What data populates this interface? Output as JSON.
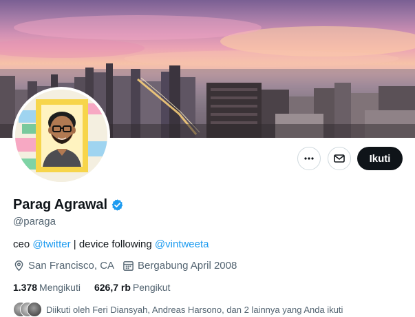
{
  "profile": {
    "display_name": "Parag Agrawal",
    "handle": "@paraga",
    "verified_icon": "verified-badge-icon",
    "bio": {
      "prefix": "ceo ",
      "mention1": "@twitter",
      "middle": " | device following ",
      "mention2": "@vintweeta"
    },
    "location": "San Francisco, CA",
    "joined": "Bergabung April 2008",
    "following_count": "1.378",
    "following_label": "Mengikuti",
    "followers_count": "626,7 rb",
    "followers_label": "Pengikut",
    "followed_by": "Diikuti oleh Feri Diansyah, Andreas Harsono, dan 2 lainnya yang Anda ikuti"
  },
  "actions": {
    "more_icon": "more-icon",
    "message_icon": "mail-icon",
    "follow_label": "Ikuti"
  },
  "colors": {
    "accent": "#1d9bf0",
    "follow_button_bg": "#0f1419",
    "secondary_text": "#536471"
  }
}
